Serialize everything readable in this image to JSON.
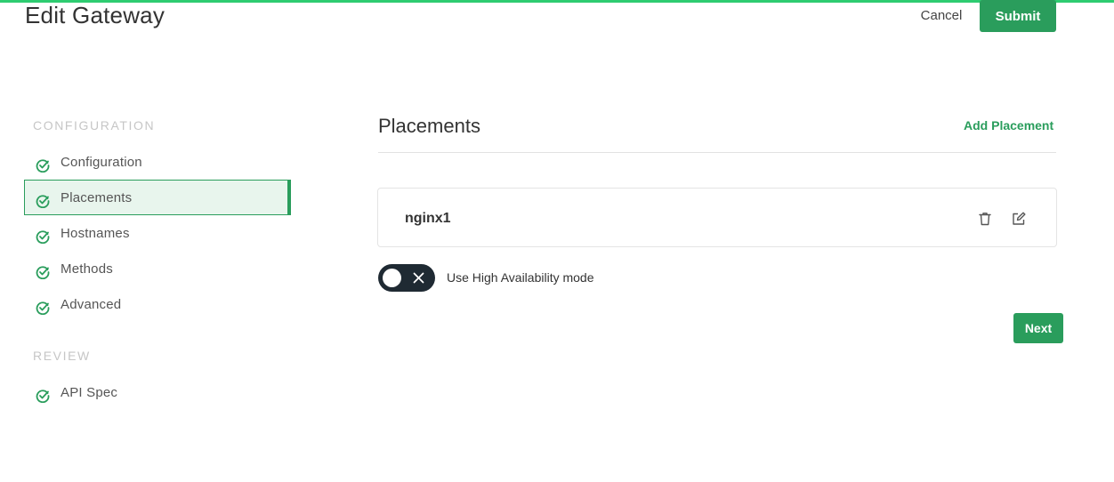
{
  "header": {
    "title": "Edit Gateway",
    "cancel_label": "Cancel",
    "submit_label": "Submit"
  },
  "sidebar": {
    "configuration_heading": "CONFIGURATION",
    "review_heading": "REVIEW",
    "items": [
      {
        "label": "Configuration",
        "status": "complete",
        "active": false
      },
      {
        "label": "Placements",
        "status": "complete",
        "active": true
      },
      {
        "label": "Hostnames",
        "status": "complete",
        "active": false
      },
      {
        "label": "Methods",
        "status": "complete",
        "active": false
      },
      {
        "label": "Advanced",
        "status": "complete",
        "active": false
      },
      {
        "label": "API Spec",
        "status": "complete",
        "active": false
      }
    ]
  },
  "main": {
    "title": "Placements",
    "add_label": "Add Placement",
    "placements": [
      {
        "name": "nginx1"
      }
    ],
    "ha_toggle": {
      "label": "Use High Availability mode",
      "enabled": false
    },
    "next_label": "Next"
  },
  "colors": {
    "accent": "#2a9d5c",
    "top_bar": "#2ecc71",
    "toggle_bg": "#1f2a33"
  },
  "icons": {
    "nav_status": "check-circle-icon",
    "delete": "trash-icon",
    "edit": "edit-icon",
    "toggle_off": "close-icon"
  }
}
